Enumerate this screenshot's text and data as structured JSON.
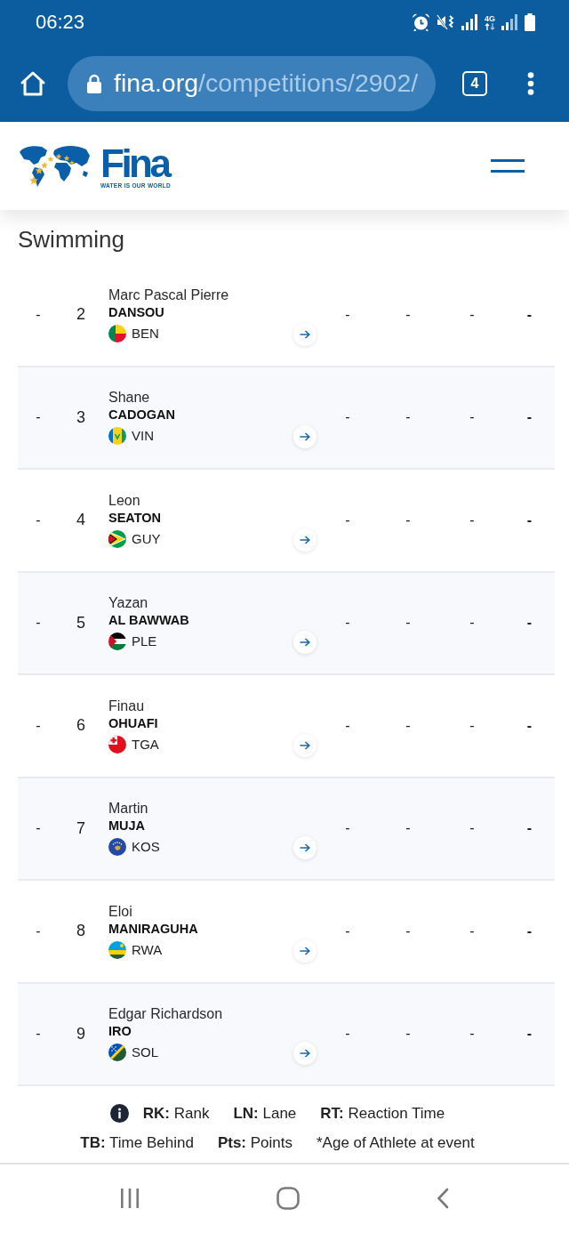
{
  "status_bar": {
    "time": "06:23",
    "network_type": "4G"
  },
  "browser": {
    "url_host": "fina.org",
    "url_path": "/competitions/2902/",
    "tab_count": "4"
  },
  "site_header": {
    "wordmark": "Fina",
    "tagline": "WATER IS OUR WORLD"
  },
  "section_title": "Swimming",
  "results": [
    {
      "column_1": "-",
      "column_2": "2",
      "first_name": "Marc Pascal Pierre",
      "last_name": "DANSOU",
      "country": "BEN",
      "flag": {
        "kind": "benin"
      },
      "column_5": "-",
      "column_6": "-",
      "column_7": "-",
      "column_8": "-"
    },
    {
      "column_1": "-",
      "column_2": "3",
      "first_name": "Shane",
      "last_name": "CADOGAN",
      "country": "VIN",
      "flag": {
        "kind": "saint-vincent"
      },
      "column_5": "-",
      "column_6": "-",
      "column_7": "-",
      "column_8": "-"
    },
    {
      "column_1": "-",
      "column_2": "4",
      "first_name": "Leon",
      "last_name": "SEATON",
      "country": "GUY",
      "flag": {
        "kind": "guyana"
      },
      "column_5": "-",
      "column_6": "-",
      "column_7": "-",
      "column_8": "-"
    },
    {
      "column_1": "-",
      "column_2": "5",
      "first_name": "Yazan",
      "last_name": "AL BAWWAB",
      "country": "PLE",
      "flag": {
        "kind": "palestine"
      },
      "column_5": "-",
      "column_6": "-",
      "column_7": "-",
      "column_8": "-"
    },
    {
      "column_1": "-",
      "column_2": "6",
      "first_name": "Finau",
      "last_name": "OHUAFI",
      "country": "TGA",
      "flag": {
        "kind": "tonga"
      },
      "column_5": "-",
      "column_6": "-",
      "column_7": "-",
      "column_8": "-"
    },
    {
      "column_1": "-",
      "column_2": "7",
      "first_name": "Martin",
      "last_name": "MUJA",
      "country": "KOS",
      "flag": {
        "kind": "kosovo"
      },
      "column_5": "-",
      "column_6": "-",
      "column_7": "-",
      "column_8": "-"
    },
    {
      "column_1": "-",
      "column_2": "8",
      "first_name": "Eloi",
      "last_name": "MANIRAGUHA",
      "country": "RWA",
      "flag": {
        "kind": "rwanda"
      },
      "column_5": "-",
      "column_6": "-",
      "column_7": "-",
      "column_8": "-"
    },
    {
      "column_1": "-",
      "column_2": "9",
      "first_name": "Edgar Richardson",
      "last_name": "IRO",
      "country": "SOL",
      "flag": {
        "kind": "solomon-islands"
      },
      "column_5": "-",
      "column_6": "-",
      "column_7": "-",
      "column_8": "-"
    }
  ],
  "legend": {
    "lines": [
      [
        "**RK:** Rank",
        "**LN:** Lane",
        "**RT:** Reaction Time"
      ],
      [
        "**TB:** Time Behind",
        "**Pts:** Points"
      ]
    ],
    "note": "*Age of Athlete at event"
  }
}
